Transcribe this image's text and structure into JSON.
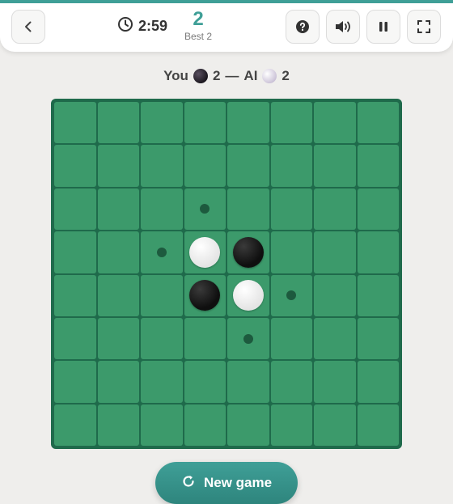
{
  "header": {
    "timer": "2:59",
    "score": "2",
    "best_label": "Best 2"
  },
  "status": {
    "you_label": "You",
    "you_count": "2",
    "separator": "—",
    "ai_label": "AI",
    "ai_count": "2"
  },
  "board": {
    "size": 8,
    "pieces": [
      {
        "row": 3,
        "col": 3,
        "color": "white"
      },
      {
        "row": 3,
        "col": 4,
        "color": "black"
      },
      {
        "row": 4,
        "col": 3,
        "color": "black"
      },
      {
        "row": 4,
        "col": 4,
        "color": "white"
      }
    ],
    "hints": [
      {
        "row": 2,
        "col": 3
      },
      {
        "row": 3,
        "col": 2
      },
      {
        "row": 4,
        "col": 5
      },
      {
        "row": 5,
        "col": 4
      }
    ]
  },
  "actions": {
    "new_game_label": "New game"
  },
  "icons": {
    "back": "chevron-left-icon",
    "timer": "clock-icon",
    "help": "question-icon",
    "sound": "speaker-icon",
    "pause": "pause-icon",
    "fullscreen": "fullscreen-icon",
    "new_game": "refresh-icon"
  },
  "colors": {
    "accent": "#3f9f97",
    "board_border": "#1f6a4b",
    "cell": "#3c9a6b",
    "hint": "#1d5a3e"
  }
}
